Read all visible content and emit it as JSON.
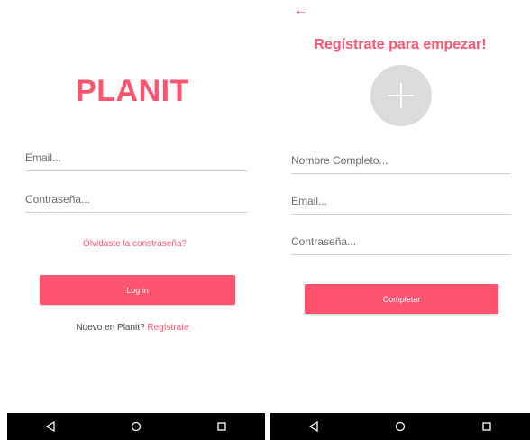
{
  "login": {
    "brand": "PLANIT",
    "email_placeholder": "Email...",
    "password_placeholder": "Contraseña...",
    "forgot_password": "Olvidaste la constraseña?",
    "login_button": "Log in",
    "new_user_text": "Nuevo en Planit?",
    "register_link": "Regístrate"
  },
  "register": {
    "back_icon": "←",
    "title": "Regístrate para empezar!",
    "avatar_icon": "add-photo-plus",
    "name_placeholder": "Nombre Completo...",
    "email_placeholder": "Email...",
    "password_placeholder": "Contraseña...",
    "submit_button": "Completar"
  },
  "navbar": {
    "icons": [
      "back-triangle",
      "home-circle",
      "recents-square"
    ]
  },
  "colors": {
    "accent": "#ff5470",
    "divider": "#cfcfcf",
    "avatar_bg": "#dadbdd",
    "navbar_bg": "#000000"
  }
}
